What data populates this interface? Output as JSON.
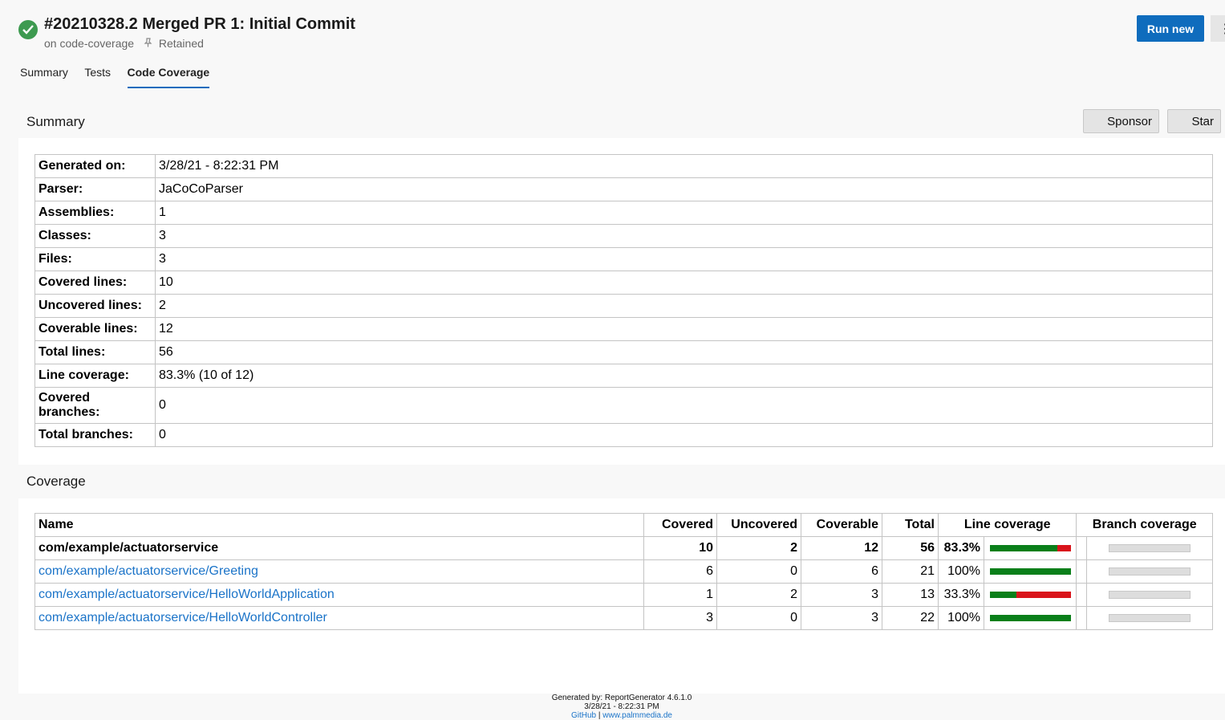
{
  "header": {
    "title": "#20210328.2 Merged PR 1: Initial Commit",
    "branch": "on code-coverage",
    "retained": "Retained",
    "run_new": "Run new",
    "more": "⋮"
  },
  "tabs": [
    "Summary",
    "Tests",
    "Code Coverage"
  ],
  "summary": {
    "title": "Summary",
    "sponsor": "Sponsor",
    "star": "Star",
    "rows": [
      {
        "label": "Generated on:",
        "value": "3/28/21 - 8:22:31 PM"
      },
      {
        "label": "Parser:",
        "value": "JaCoCoParser"
      },
      {
        "label": "Assemblies:",
        "value": "1"
      },
      {
        "label": "Classes:",
        "value": "3"
      },
      {
        "label": "Files:",
        "value": "3"
      },
      {
        "label": "Covered lines:",
        "value": "10"
      },
      {
        "label": "Uncovered lines:",
        "value": "2"
      },
      {
        "label": "Coverable lines:",
        "value": "12"
      },
      {
        "label": "Total lines:",
        "value": "56"
      },
      {
        "label": "Line coverage:",
        "value": "83.3% (10 of 12)"
      },
      {
        "label": "Covered branches:",
        "value": "0"
      },
      {
        "label": "Total branches:",
        "value": "0"
      }
    ]
  },
  "coverage": {
    "title": "Coverage",
    "headers": {
      "name": "Name",
      "covered": "Covered",
      "uncovered": "Uncovered",
      "coverable": "Coverable",
      "total": "Total",
      "line_coverage": "Line coverage",
      "branch_coverage": "Branch coverage"
    },
    "rows": [
      {
        "name": "com/example/actuatorservice",
        "covered": "10",
        "uncovered": "2",
        "coverable": "12",
        "total": "56",
        "pct": "83.3%",
        "fraction": 0.833
      },
      {
        "name": "com/example/actuatorservice/Greeting",
        "covered": "6",
        "uncovered": "0",
        "coverable": "6",
        "total": "21",
        "pct": "100%",
        "fraction": 1.0
      },
      {
        "name": "com/example/actuatorservice/HelloWorldApplication",
        "covered": "1",
        "uncovered": "2",
        "coverable": "3",
        "total": "13",
        "pct": "33.3%",
        "fraction": 0.333
      },
      {
        "name": "com/example/actuatorservice/HelloWorldController",
        "covered": "3",
        "uncovered": "0",
        "coverable": "3",
        "total": "22",
        "pct": "100%",
        "fraction": 1.0
      }
    ]
  },
  "footer": {
    "generated_by": "Generated by: ReportGenerator 4.6.1.0",
    "date": "3/28/21 - 8:22:31 PM",
    "github": "GitHub",
    "separator": "|",
    "site": "www.palmmedia.de"
  },
  "colors": {
    "accent": "#0f6cbd",
    "success": "#3d9a50",
    "covered": "#0a7f1a",
    "uncovered": "#d9141b"
  }
}
